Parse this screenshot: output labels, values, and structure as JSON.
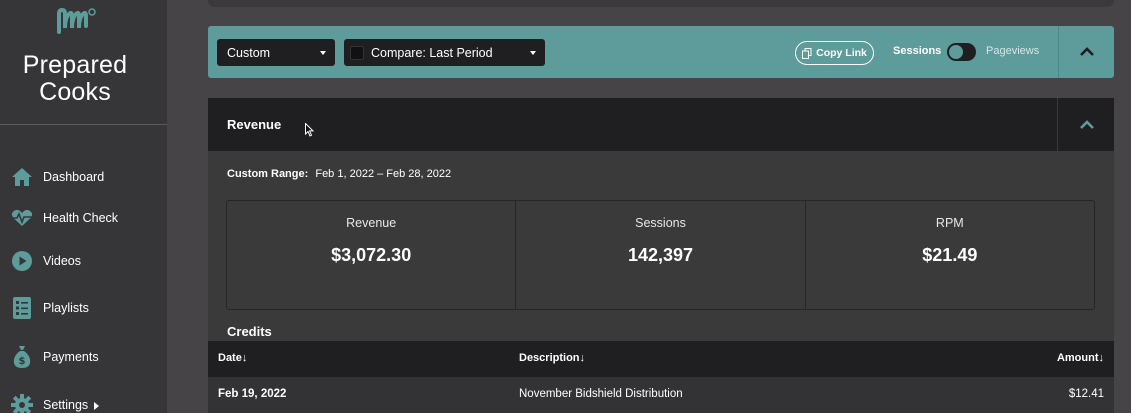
{
  "sidebar": {
    "brand_line1": "Prepared",
    "brand_line2": "Cooks",
    "items": [
      {
        "label": "Dashboard",
        "icon": "home-icon"
      },
      {
        "label": "Health Check",
        "icon": "heartbeat-icon"
      },
      {
        "label": "Videos",
        "icon": "play-icon"
      },
      {
        "label": "Playlists",
        "icon": "checklist-icon"
      },
      {
        "label": "Payments",
        "icon": "money-bag-icon"
      },
      {
        "label": "Settings",
        "icon": "gear-icon"
      }
    ]
  },
  "filter_bar": {
    "range_select": "Custom",
    "compare_select": "Compare: Last Period",
    "copy_link": "Copy Link",
    "toggle_left": "Sessions",
    "toggle_right": "Pageviews"
  },
  "revenue": {
    "title": "Revenue",
    "range_label": "Custom Range:",
    "range_value": "Feb 1, 2022 – Feb 28, 2022",
    "stats": [
      {
        "label": "Revenue",
        "value": "$3,072.30"
      },
      {
        "label": "Sessions",
        "value": "142,397"
      },
      {
        "label": "RPM",
        "value": "$21.49"
      }
    ],
    "credits_title": "Credits",
    "columns": {
      "date": "Date↓",
      "description": "Description↓",
      "amount": "Amount↓"
    },
    "rows": [
      {
        "date": "Feb 19, 2022",
        "description": "November Bidshield Distribution",
        "amount": "$12.41"
      }
    ]
  },
  "colors": {
    "accent": "#5d9c9a",
    "sidebar": "#363638",
    "panel": "#3a3a3b",
    "dark": "#1f1e20"
  }
}
